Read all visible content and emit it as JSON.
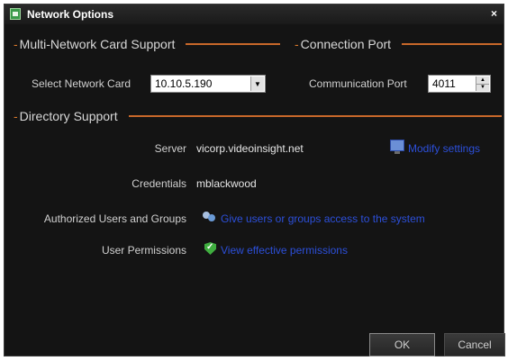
{
  "window": {
    "title": "Network Options",
    "close_glyph": "×"
  },
  "sections": {
    "multi_network": "Multi-Network Card Support",
    "connection_port": "Connection Port",
    "directory_support": "Directory Support",
    "dash": "-"
  },
  "network_card": {
    "label": "Select Network Card",
    "value": "10.10.5.190",
    "arrow": "▼"
  },
  "communication_port": {
    "label": "Communication Port",
    "value": "4011",
    "up": "▲",
    "down": "▼"
  },
  "directory": {
    "server_label": "Server",
    "server_value": "vicorp.videoinsight.net",
    "modify_link": "Modify settings",
    "credentials_label": "Credentials",
    "credentials_value": "mblackwood",
    "authorized_label": "Authorized Users and Groups",
    "authorized_link": "Give users or groups access to the system",
    "permissions_label": "User Permissions",
    "permissions_link": "View effective permissions"
  },
  "buttons": {
    "ok": "OK",
    "cancel": "Cancel"
  },
  "colors": {
    "accent_rule": "#c8682a",
    "link": "#2c4fd9",
    "background": "#141414"
  },
  "icons": [
    "window-app-icon",
    "monitor-icon",
    "users-icon",
    "shield-check-icon"
  ]
}
